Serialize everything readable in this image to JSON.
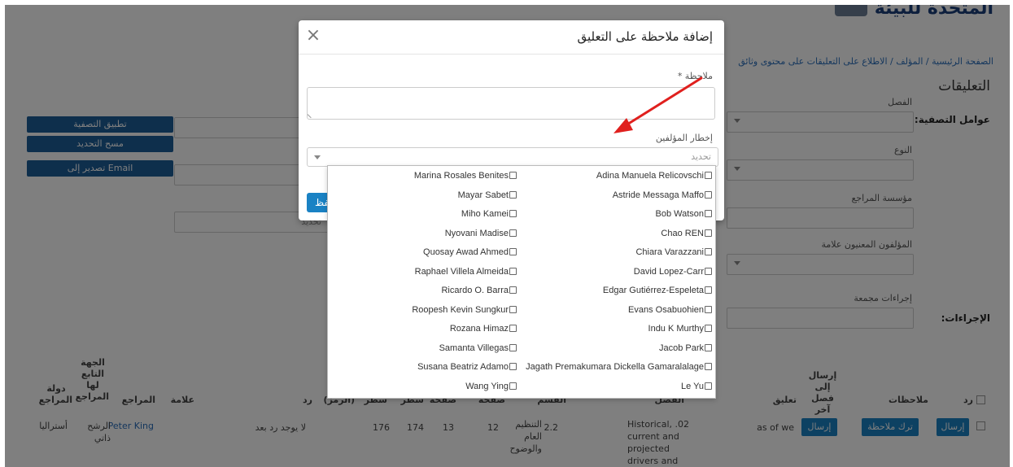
{
  "background": {
    "site_title": "المتحدة للبيئة",
    "breadcrumb": "الصفحة الرئيسية / المؤلف / الاطلاع على التعليقات على محتوى وثائق",
    "section_title": "التعليقات",
    "filter_label": "عوامل التصفية:",
    "actions_label": "الإجراءات:",
    "filters": {
      "chapter_label": "الفصل",
      "type_label": "النوع",
      "reviewer_org_label": "مؤسسة المراجع",
      "authors_label": "المؤلفون المعنيون علامة",
      "bulk_actions_label": "إجراءات مجمعة",
      "select_placeholder": "تحديد"
    },
    "tool_buttons": {
      "apply_filter": "تطبيق التصفية",
      "clear_selection": "مسح التحديد",
      "export_email": "تصدير إلى Email"
    },
    "table": {
      "headers": {
        "reply": "رد",
        "notes": "ملاحظات",
        "send_other_chapter": "إرسال إلى فصل آخر",
        "comment": "تعليق",
        "chapter": "الفصل",
        "section": "القسم",
        "page": "صفحة",
        "page_to": "صفحة",
        "line": "سطر",
        "line_to": "سطر",
        "code": "(الرمز)",
        "reply2": "رد",
        "mark": "علامة",
        "reviewer": "المراجع",
        "reviewer_affiliation": "الجهة التابع لها المراجع",
        "reviewer_country": "دولة المراجع"
      },
      "row": {
        "send_button": "إرسال",
        "add_note_button": "ترك ملاحظة",
        "send_other_button": "إرسال",
        "comment": "as of we",
        "chapter": "Historical, .02 current and projected drivers and",
        "section": "2.2",
        "topic": "التنظيم العام والوضوح",
        "page_from": "12",
        "page_to": "13",
        "line_from": "174",
        "line_to": "176",
        "reply_text": "لا يوجد رد بعد",
        "reviewer": "Peter King",
        "affiliation": "الرشح ذاتي",
        "country": "أستراليا"
      }
    }
  },
  "modal": {
    "title": "إضافة ملاحظة على التعليق",
    "note_label": "ملاحظة *",
    "notify_label": "إخطار المؤلفين",
    "notify_placeholder": "تحديد",
    "save_label": "حفظ",
    "close_glyph": "×"
  },
  "authors_left": [
    "Marina Rosales Benites",
    "Mayar Sabet",
    "Miho Kamei",
    "Nyovani Madise",
    "Quosay Awad Ahmed",
    "Raphael Villela Almeida",
    "Ricardo O. Barra",
    "Roopesh Kevin Sungkur",
    "Rozana Himaz",
    "Samanta Villegas",
    "Susana Beatriz Adamo",
    "Wang Ying"
  ],
  "authors_right": [
    "Adina Manuela Relicovschi",
    "Astride Messaga Maffo",
    "Bob Watson",
    "Chao REN",
    "Chiara Varazzani",
    "David Lopez-Carr",
    "Edgar Gutiérrez-Espeleta",
    "Evans Osabuohien",
    "Indu K Murthy",
    "Jacob Park",
    "Jagath Premakumara Dickella Gamaralalage",
    "Le Yu"
  ],
  "colors": {
    "primary_button": "#1a82c4",
    "overlay": "rgba(0,0,0,0.5)",
    "annotation_arrow": "#e0201e"
  }
}
